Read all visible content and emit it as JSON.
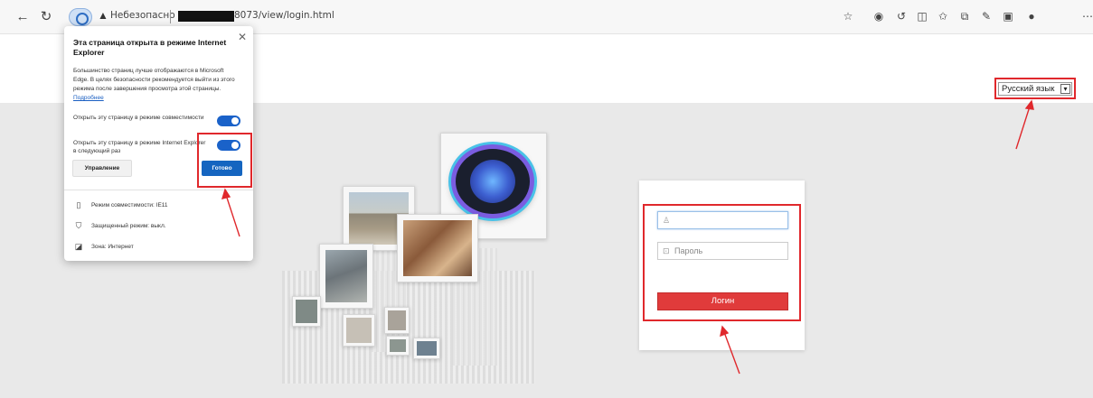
{
  "browser": {
    "back_icon": "back-arrow-icon",
    "refresh_icon": "refresh-icon",
    "insecure_label": "Небезопасно",
    "url_tail": "8073/view/login.html"
  },
  "ie_popup": {
    "title": "Эта страница открыта в режиме Internet Explorer",
    "description": "Большинство страниц лучше отображаются в Microsoft Edge. В целях безопасности рекомендуется выйти из этого режима после завершения просмотра этой страницы.",
    "learn_more": "Подробнее",
    "option_compat": "Открыть эту страницу в режиме совместимости",
    "option_next_time": "Открыть эту страницу в режиме Internet Explorer в следующий раз",
    "manage_label": "Управление",
    "done_label": "Готово",
    "info_compat_mode": "Режим совместимости: IE11",
    "info_protected_mode": "Защищенный режим: выкл.",
    "info_zone": "Зона: Интернет"
  },
  "login": {
    "language": "Русский язык",
    "username_placeholder": "",
    "password_placeholder": "Пароль",
    "login_label": "Логин"
  },
  "colors": {
    "highlight": "#e0282c",
    "login_button": "#e03b3b",
    "toggle_on": "#1a62c9",
    "done_button": "#1565c0"
  }
}
